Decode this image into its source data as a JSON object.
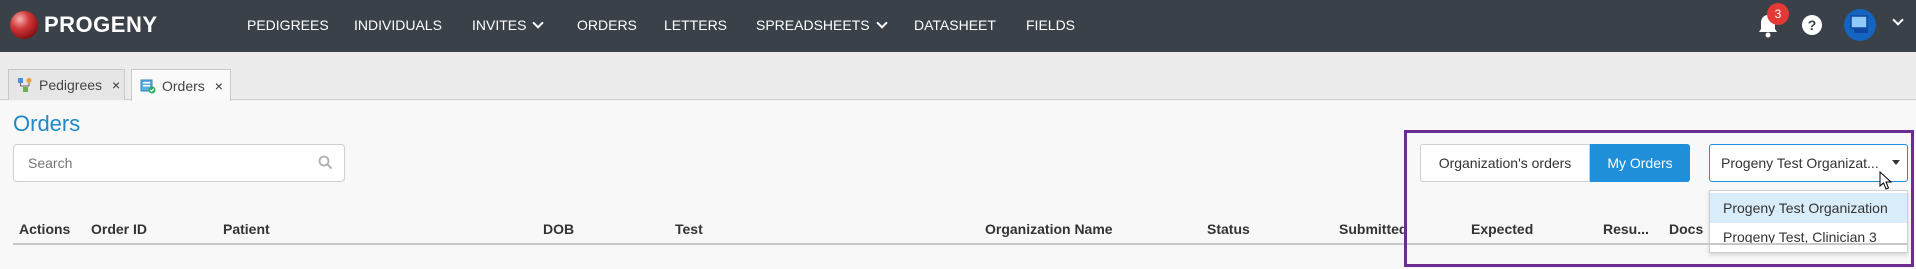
{
  "app": {
    "brand": "PROGENY"
  },
  "nav": {
    "items": [
      {
        "label": "PEDIGREES"
      },
      {
        "label": "INDIVIDUALS"
      },
      {
        "label": "INVITES"
      },
      {
        "label": "ORDERS"
      },
      {
        "label": "LETTERS"
      },
      {
        "label": "SPREADSHEETS"
      },
      {
        "label": "DATASHEET"
      },
      {
        "label": "FIELDS"
      }
    ]
  },
  "header": {
    "notifications_count": "3",
    "help_symbol": "?"
  },
  "tabs": [
    {
      "label": "Pedigrees",
      "close": "×"
    },
    {
      "label": "Orders",
      "close": "×"
    }
  ],
  "page": {
    "title": "Orders",
    "search_placeholder": "Search"
  },
  "toggle": {
    "org_label": "Organization's orders",
    "my_label": "My Orders"
  },
  "org_select": {
    "value": "Progeny Test Organizat...",
    "options": [
      {
        "label": "Progeny Test Organization"
      },
      {
        "label": "Progeny Test, Clinician 3"
      }
    ]
  },
  "table": {
    "columns": [
      {
        "label": "Actions"
      },
      {
        "label": "Order ID"
      },
      {
        "label": "Patient"
      },
      {
        "label": "DOB"
      },
      {
        "label": "Test"
      },
      {
        "label": "Organization Name"
      },
      {
        "label": "Status"
      },
      {
        "label": "Submitted"
      },
      {
        "label": "Expected"
      },
      {
        "label": "Resu..."
      },
      {
        "label": "Docs"
      }
    ]
  },
  "colors": {
    "topbar": "#3a4149",
    "accent": "#1e8fd8",
    "title": "#1e88c8",
    "badge": "#e53935",
    "highlight": "#6a2c91"
  }
}
